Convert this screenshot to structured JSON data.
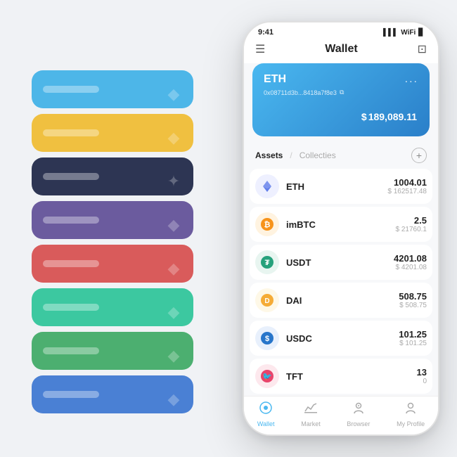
{
  "page": {
    "background": "#f0f2f5"
  },
  "cards": [
    {
      "id": "card-1",
      "color": "card-blue",
      "icon": "◆"
    },
    {
      "id": "card-2",
      "color": "card-yellow",
      "icon": "◆"
    },
    {
      "id": "card-3",
      "color": "card-dark",
      "icon": "✦"
    },
    {
      "id": "card-4",
      "color": "card-purple",
      "icon": "◆"
    },
    {
      "id": "card-5",
      "color": "card-red",
      "icon": "◆"
    },
    {
      "id": "card-6",
      "color": "card-teal",
      "icon": "◆"
    },
    {
      "id": "card-7",
      "color": "card-green",
      "icon": "◆"
    },
    {
      "id": "card-8",
      "color": "card-blue2",
      "icon": "◆"
    }
  ],
  "statusBar": {
    "time": "9:41",
    "signal": "▌▌▌",
    "wifi": "WiFi",
    "battery": "🔋"
  },
  "header": {
    "menu_icon": "☰",
    "title": "Wallet",
    "scan_icon": "⊡"
  },
  "walletCard": {
    "name": "ETH",
    "more_icon": "...",
    "address": "0x08711d3b...8418a7f8e3",
    "address_copy_icon": "⧉",
    "balance_symbol": "$",
    "balance": "189,089.11"
  },
  "assetsSection": {
    "tab_assets": "Assets",
    "slash": "/",
    "tab_collecties": "Collecties",
    "add_icon": "+"
  },
  "assets": [
    {
      "symbol": "ETH",
      "name": "ETH",
      "icon": "◈",
      "icon_color": "#627eea",
      "balance": "1004.01",
      "usd": "$ 162517.48"
    },
    {
      "symbol": "imBTC",
      "name": "imBTC",
      "icon": "₿",
      "icon_color": "#f7931a",
      "balance": "2.5",
      "usd": "$ 21760.1"
    },
    {
      "symbol": "USDT",
      "name": "USDT",
      "icon": "₮",
      "icon_color": "#26a17b",
      "balance": "4201.08",
      "usd": "$ 4201.08"
    },
    {
      "symbol": "DAI",
      "name": "DAI",
      "icon": "◉",
      "icon_color": "#f5ac37",
      "balance": "508.75",
      "usd": "$ 508.75"
    },
    {
      "symbol": "USDC",
      "name": "USDC",
      "icon": "$",
      "icon_color": "#2775ca",
      "balance": "101.25",
      "usd": "$ 101.25"
    },
    {
      "symbol": "TFT",
      "name": "TFT",
      "icon": "🐦",
      "icon_color": "#e8436b",
      "balance": "13",
      "usd": "0"
    }
  ],
  "bottomNav": [
    {
      "id": "wallet",
      "label": "Wallet",
      "icon": "◎",
      "active": true
    },
    {
      "id": "market",
      "label": "Market",
      "icon": "📈",
      "active": false
    },
    {
      "id": "browser",
      "label": "Browser",
      "icon": "👤",
      "active": false
    },
    {
      "id": "profile",
      "label": "My Profile",
      "icon": "👤",
      "active": false
    }
  ]
}
